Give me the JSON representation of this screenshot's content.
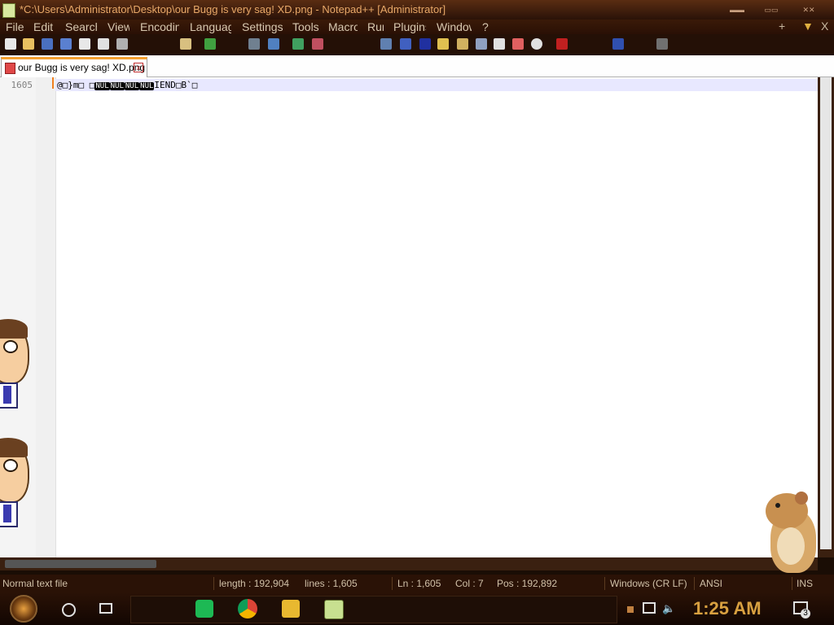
{
  "window": {
    "title": "*C:\\Users\\Administrator\\Desktop\\our Bugg is very sag! XD.png - Notepad++ [Administrator]",
    "controls": [
      "minimize",
      "maximize",
      "close"
    ]
  },
  "menu": {
    "items": [
      "File",
      "Edit",
      "Search",
      "View",
      "Encoding",
      "Language",
      "Settings",
      "Tools",
      "Macro",
      "Run",
      "Plugins",
      "Window",
      "?"
    ],
    "right_plus": "+",
    "right_down": "▼",
    "right_close": "X"
  },
  "toolbar": {
    "icons": [
      "new-file-icon",
      "open-file-icon",
      "save-icon",
      "save-all-icon",
      "close-icon",
      "close-all-icon",
      "print-icon",
      "paste-icon",
      "redo-icon",
      "find-icon",
      "replace-icon",
      "zoom-in-icon",
      "zoom-out-icon",
      "sync-scroll-icon",
      "show-all-chars-icon",
      "word-wrap-icon",
      "indent-guide-icon",
      "doc-map-icon",
      "function-list-icon",
      "folder-workspace-icon",
      "monitoring-icon",
      "record-macro-icon",
      "run-macro-icon",
      "spell-check-icon"
    ]
  },
  "tab": {
    "label": "our Bugg is very sag! XD.png",
    "close": "x"
  },
  "editor": {
    "line_number": "1605",
    "code_parts": [
      {
        "text": "@□}m□ □",
        "ctl": false
      },
      {
        "text": "NUL",
        "ctl": true
      },
      {
        "text": "NUL",
        "ctl": true
      },
      {
        "text": "NUL",
        "ctl": true
      },
      {
        "text": "NUL",
        "ctl": true
      },
      {
        "text": "IEND□B`□",
        "ctl": false
      }
    ]
  },
  "status": {
    "file_type": "Normal text file",
    "length": "length : 192,904",
    "lines": "lines : 1,605",
    "ln": "Ln : 1,605",
    "col": "Col : 7",
    "pos": "Pos : 192,892",
    "eol": "Windows (CR LF)",
    "encoding": "ANSI",
    "mode": "INS"
  },
  "taskbar": {
    "clock": "1:25 AM",
    "notification_count": "3",
    "apps": [
      "spotify-icon",
      "chrome-icon",
      "file-explorer-icon",
      "notepadpp-icon"
    ]
  },
  "colors": {
    "accent": "#f5a030",
    "titlebar_text": "#e8a868",
    "clock": "#d8a040",
    "theme_bg": "#2a1206"
  }
}
